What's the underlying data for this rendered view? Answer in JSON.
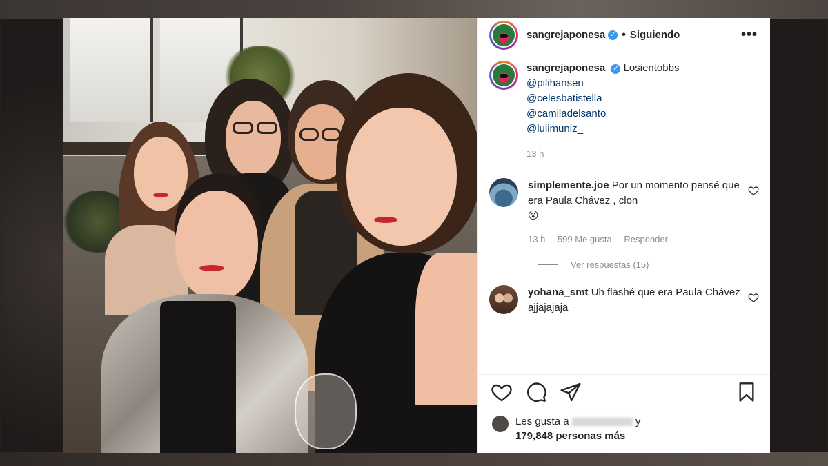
{
  "post": {
    "account": {
      "username": "sangrejaponesa",
      "follow_status": "Siguiendo",
      "more_icon": "more-icon"
    },
    "caption": {
      "username": "sangrejaponesa",
      "text": "Losientobbs",
      "mentions": [
        "@pilihansen",
        "@celesbatistella",
        "@camiladelsanto",
        "@lulimuniz_"
      ],
      "time": "13 h"
    },
    "comments": [
      {
        "username": "simplemente.joe",
        "text": "Por un momento pensé que era Paula Chávez , clon",
        "emoji": "😮",
        "time": "13 h",
        "likes": "599 Me gusta",
        "reply": "Responder",
        "view_replies": "Ver respuestas (15)"
      },
      {
        "username": "yohana_smt",
        "text": "Uh flashé que era Paula Chávez ajjajajaja"
      }
    ],
    "likes_prefix": "Les gusta a",
    "likes_suffix": "y",
    "likes_count": "179,848 personas más",
    "colors": {
      "mention": "#00376b",
      "muted": "#8e8e8e",
      "verified": "#3897f0"
    }
  }
}
